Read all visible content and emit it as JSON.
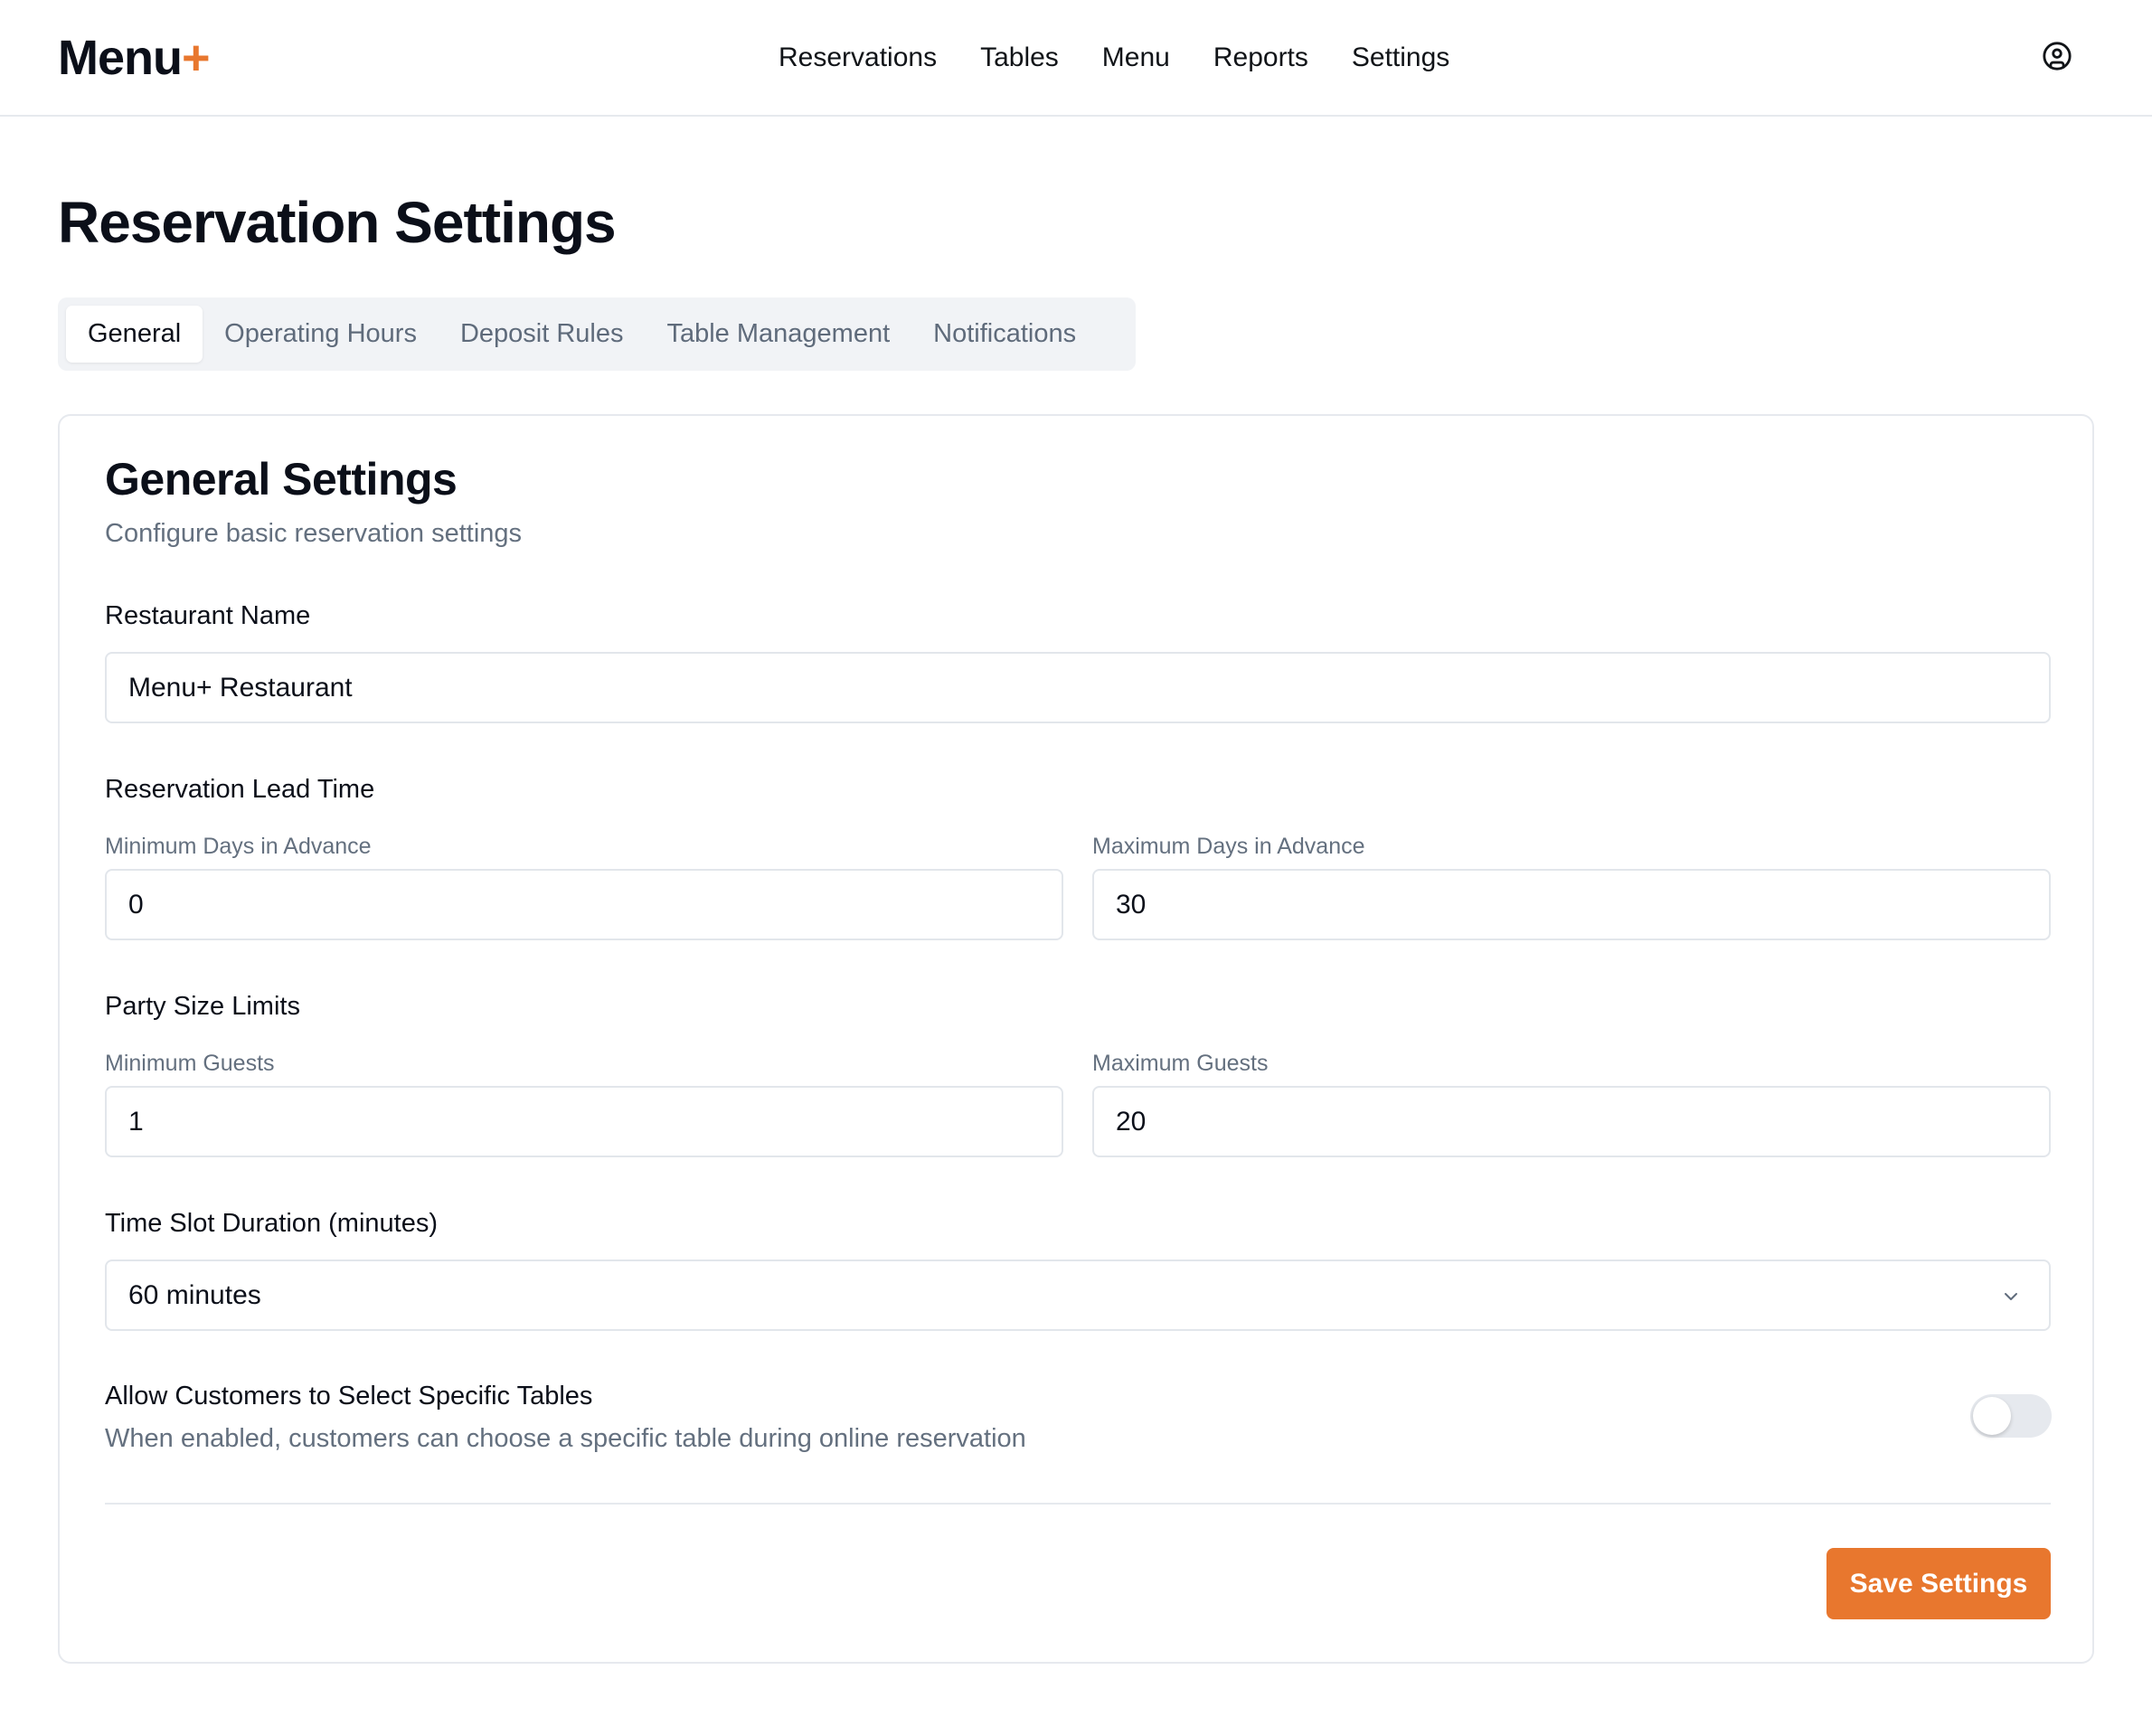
{
  "header": {
    "logo_text": "Menu",
    "logo_plus": "+",
    "nav": [
      "Reservations",
      "Tables",
      "Menu",
      "Reports",
      "Settings"
    ],
    "user_icon": "user-circle-icon"
  },
  "page": {
    "title": "Reservation Settings"
  },
  "tabs": [
    {
      "label": "General",
      "active": true
    },
    {
      "label": "Operating Hours",
      "active": false
    },
    {
      "label": "Deposit Rules",
      "active": false
    },
    {
      "label": "Table Management",
      "active": false
    },
    {
      "label": "Notifications",
      "active": false
    }
  ],
  "general": {
    "title": "General Settings",
    "subtitle": "Configure basic reservation settings",
    "restaurant_name": {
      "label": "Restaurant Name",
      "value": "Menu+ Restaurant"
    },
    "lead_time": {
      "label": "Reservation Lead Time",
      "min_label": "Minimum Days in Advance",
      "min_value": "0",
      "max_label": "Maximum Days in Advance",
      "max_value": "30"
    },
    "party_size": {
      "label": "Party Size Limits",
      "min_label": "Minimum Guests",
      "min_value": "1",
      "max_label": "Maximum Guests",
      "max_value": "20"
    },
    "time_slot": {
      "label": "Time Slot Duration (minutes)",
      "value": "60 minutes",
      "icon": "chevron-down-icon"
    },
    "table_selection": {
      "label": "Allow Customers to Select Specific Tables",
      "description": "When enabled, customers can choose a specific table during online reservation",
      "enabled": false
    },
    "save_label": "Save Settings"
  },
  "colors": {
    "accent": "#e8772e",
    "text": "#0b0f19",
    "muted": "#64707f",
    "border": "#e2e6eb",
    "tab_bg": "#f1f3f6"
  }
}
